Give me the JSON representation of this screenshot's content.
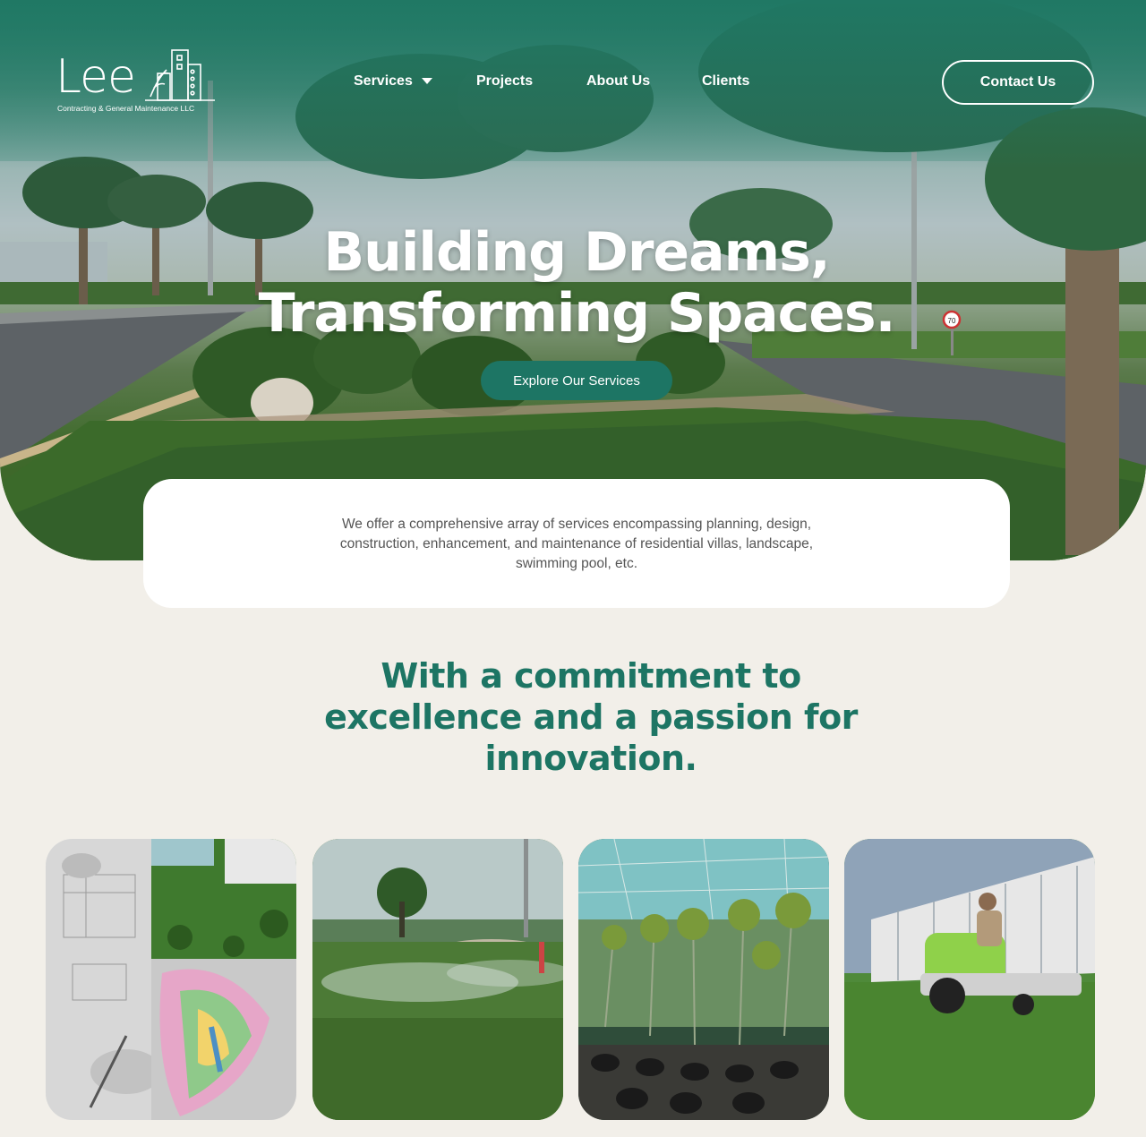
{
  "brand": {
    "name": "Lee",
    "tagline": "Contracting & General Maintenance LLC"
  },
  "nav": {
    "items": [
      {
        "label": "Services",
        "has_dropdown": true
      },
      {
        "label": "Projects"
      },
      {
        "label": "About Us"
      },
      {
        "label": "Clients"
      }
    ],
    "contact_label": "Contact Us"
  },
  "hero": {
    "title_line1": "Building Dreams,",
    "title_line2": "Transforming Spaces.",
    "cta_label": "Explore Our Services",
    "speed_sign": "70"
  },
  "intro": {
    "text": "We offer a comprehensive array of services encompassing planning, design, construction, enhancement, and maintenance of residential villas, landscape, swimming pool, etc."
  },
  "commitment": {
    "heading": "With a commitment to excellence and a passion for innovation."
  },
  "gallery": [
    {
      "name": "design-planning"
    },
    {
      "name": "irrigation"
    },
    {
      "name": "nursery"
    },
    {
      "name": "maintenance"
    }
  ],
  "colors": {
    "brand_green": "#1d7564",
    "page_bg": "#f2efe9",
    "white": "#ffffff"
  }
}
